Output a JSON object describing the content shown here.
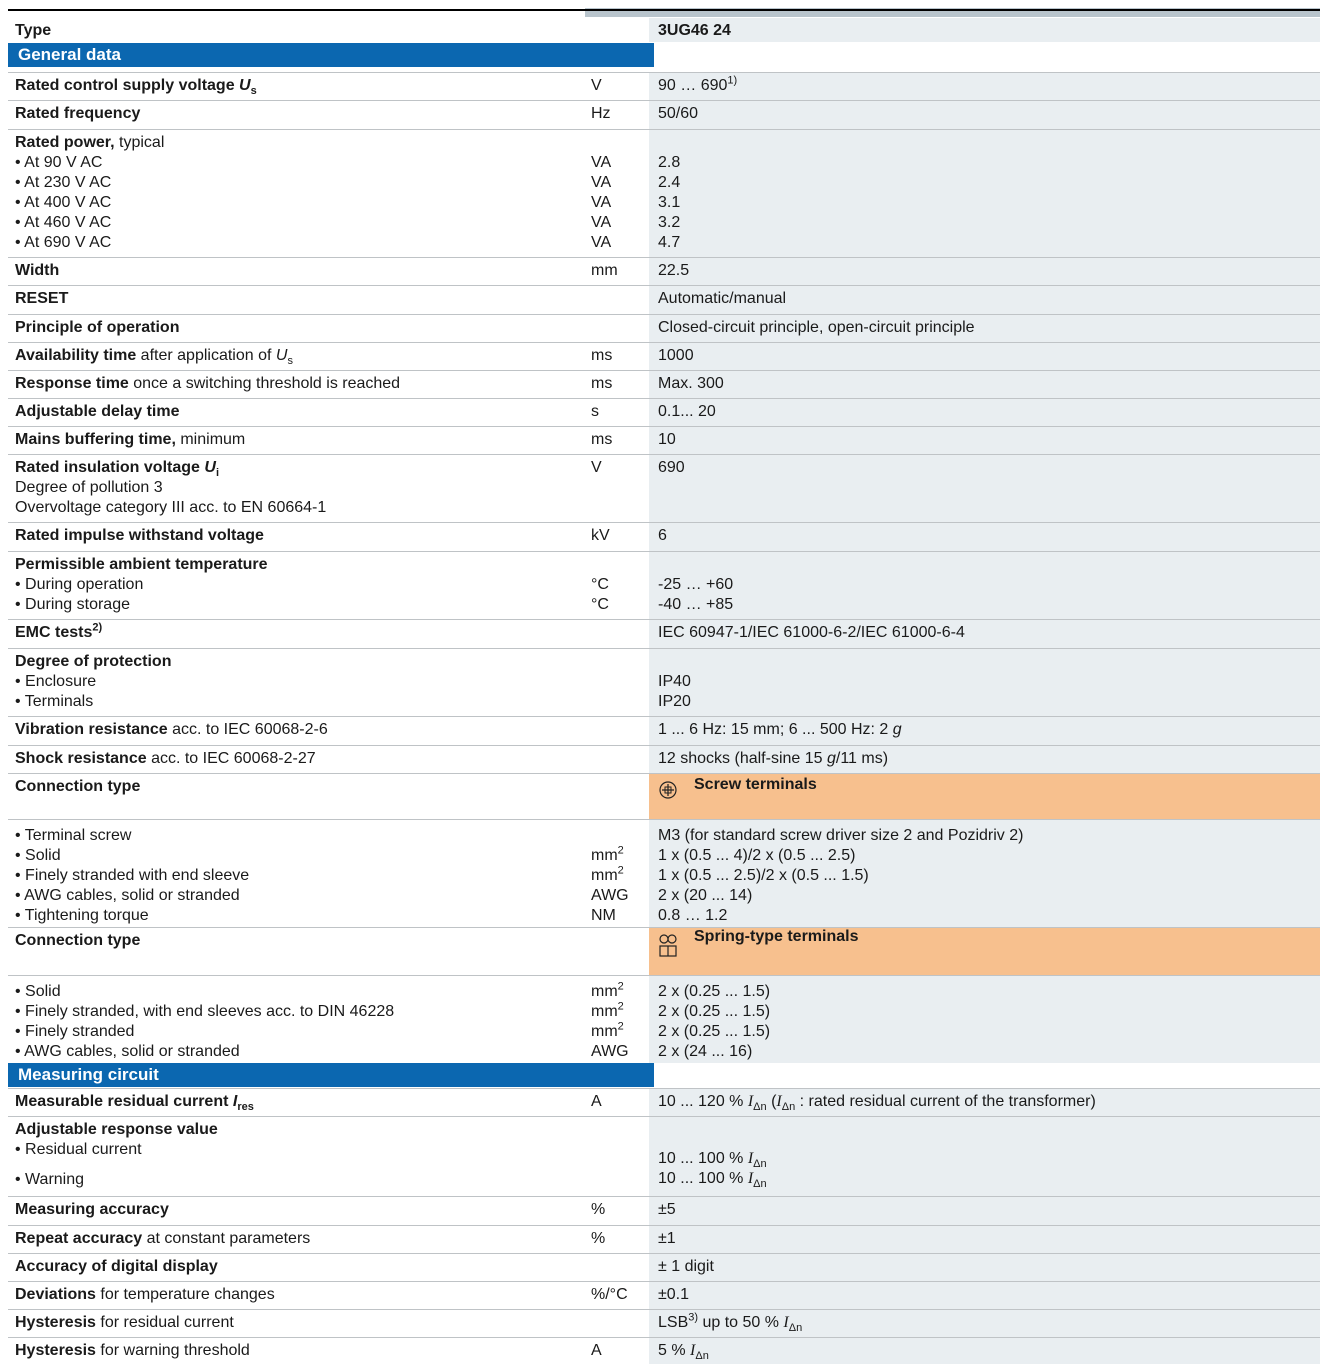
{
  "header": {
    "type_label": "Type",
    "type_value": "3UG46 24"
  },
  "sections": {
    "general": "General data",
    "measuring": "Measuring circuit"
  },
  "rows": {
    "supply": {
      "label": "Rated control supply voltage",
      "sym": "U",
      "sub": "s",
      "unit": "V",
      "value": "90 … 690",
      "sup": "1)"
    },
    "freq": {
      "label": "Rated frequency",
      "unit": "Hz",
      "value": "50/60"
    },
    "power": {
      "label": "Rated power,",
      "label2": " typical",
      "items": [
        "• At 90 V AC",
        "• At 230 V AC",
        "• At 400 V AC",
        "• At 460 V AC",
        "• At 690 V AC"
      ],
      "units": [
        "VA",
        "VA",
        "VA",
        "VA",
        "VA"
      ],
      "values": [
        "2.8",
        "2.4",
        "3.1",
        "3.2",
        "4.7"
      ]
    },
    "width": {
      "label": "Width",
      "unit": "mm",
      "value": "22.5"
    },
    "reset": {
      "label": "RESET",
      "value": "Automatic/manual"
    },
    "principle": {
      "label": "Principle of operation",
      "value": "Closed-circuit principle, open-circuit principle"
    },
    "avail": {
      "label": "Availability time",
      "label2": " after application of ",
      "sym": "U",
      "sub": "s",
      "unit": "ms",
      "value": "1000"
    },
    "response": {
      "label": "Response time",
      "label2": " once a switching threshold is reached",
      "unit": "ms",
      "value": "Max. 300"
    },
    "delay": {
      "label": "Adjustable delay time",
      "unit": "s",
      "value": "0.1... 20"
    },
    "mains": {
      "label": "Mains buffering time,",
      "label2": " minimum",
      "unit": "ms",
      "value": "10"
    },
    "insul": {
      "label": "Rated insulation voltage",
      "sym": "U",
      "sub": "i",
      "unit": "V",
      "value": "690",
      "line2": "Degree of pollution 3",
      "line3": "Overvoltage category III acc. to EN 60664-1"
    },
    "impulse": {
      "label": "Rated impulse withstand voltage",
      "unit": "kV",
      "value": "6"
    },
    "ambient": {
      "label": "Permissible ambient temperature",
      "items": [
        "• During operation",
        "• During storage"
      ],
      "units": [
        "°C",
        "°C"
      ],
      "values": [
        "-25 … +60",
        "-40 … +85"
      ]
    },
    "emc": {
      "label": "EMC tests",
      "sup": "2)",
      "value": "IEC 60947-1/IEC 61000-6-2/IEC 61000-6-4"
    },
    "protection": {
      "label": "Degree of protection",
      "items": [
        "• Enclosure",
        "• Terminals"
      ],
      "values": [
        "IP40",
        "IP20"
      ]
    },
    "vibration": {
      "label": "Vibration resistance",
      "label2": " acc. to IEC 60068-2-6",
      "value": "1 ... 6 Hz: 15 mm; 6 ... 500 Hz: 2 ",
      "g": "g"
    },
    "shock": {
      "label": "Shock resistance",
      "label2": " acc. to IEC 60068-2-27",
      "value": "12 shocks (half-sine 15 ",
      "g": "g",
      "value2": "/11 ms)"
    },
    "conn1": {
      "label": "Connection type",
      "value": "Screw terminals"
    },
    "screw": {
      "items": [
        "• Terminal screw",
        "• Solid",
        "• Finely stranded with end sleeve",
        "• AWG cables, solid or stranded",
        "• Tightening torque"
      ],
      "units": [
        "",
        "mm",
        "mm",
        "AWG",
        "NM"
      ],
      "sups": [
        "",
        "2",
        "2",
        "",
        ""
      ],
      "values": [
        "M3 (for standard screw driver size 2 and Pozidriv 2)",
        "1 x (0.5 ... 4)/2 x (0.5 ... 2.5)",
        "1 x (0.5 ... 2.5)/2 x (0.5 ... 1.5)",
        "2 x (20 ... 14)",
        "0.8 … 1.2"
      ]
    },
    "conn2": {
      "label": "Connection type",
      "value": "Spring-type terminals"
    },
    "spring": {
      "items": [
        "• Solid",
        "• Finely stranded, with end sleeves acc. to DIN 46228",
        "• Finely stranded",
        "• AWG cables, solid or stranded"
      ],
      "units": [
        "mm",
        "mm",
        "mm",
        "AWG"
      ],
      "sups": [
        "2",
        "2",
        "2",
        ""
      ],
      "values": [
        "2 x (0.25 ... 1.5)",
        "2 x (0.25 ... 1.5)",
        "2 x (0.25 ... 1.5)",
        "2 x (24 ... 16)"
      ]
    },
    "residual": {
      "label": "Measurable residual current",
      "sym": "I",
      "sub": "res",
      "unit": "A",
      "value": "10 ... 120 % ",
      "value2": " (",
      "value3": " : rated residual current of the transformer)",
      "isym": "I",
      "isub": "Δn"
    },
    "adjresp": {
      "label": "Adjustable response value",
      "items": [
        "• Residual current",
        "• Warning"
      ],
      "values": [
        "10 ... 100 % ",
        "10 ... 100 % "
      ],
      "isym": "I",
      "isub": "Δn"
    },
    "measacc": {
      "label": "Measuring accuracy",
      "unit": "%",
      "value": "±5"
    },
    "repeat": {
      "label": "Repeat accuracy",
      "label2": " at constant parameters",
      "unit": "%",
      "value": "±1"
    },
    "digital": {
      "label": "Accuracy of digital display",
      "value": "± 1 digit"
    },
    "dev": {
      "label": "Deviations",
      "label2": " for temperature changes",
      "unit": "%/°C",
      "value": "±0.1"
    },
    "hyst1": {
      "label": "Hysteresis",
      "label2": " for residual current",
      "value": "LSB",
      "sup": "3)",
      "value2": " up to 50 % ",
      "isym": "I",
      "isub": "Δn"
    },
    "hyst2": {
      "label": "Hysteresis",
      "label2": " for warning threshold",
      "unit": "A",
      "value": "5 % ",
      "isym": "I",
      "isub": "Δn"
    }
  },
  "colors": {
    "section_blue": "#0b67b0",
    "value_bg": "#e9eef1",
    "connection_orange": "#f7c08e"
  }
}
